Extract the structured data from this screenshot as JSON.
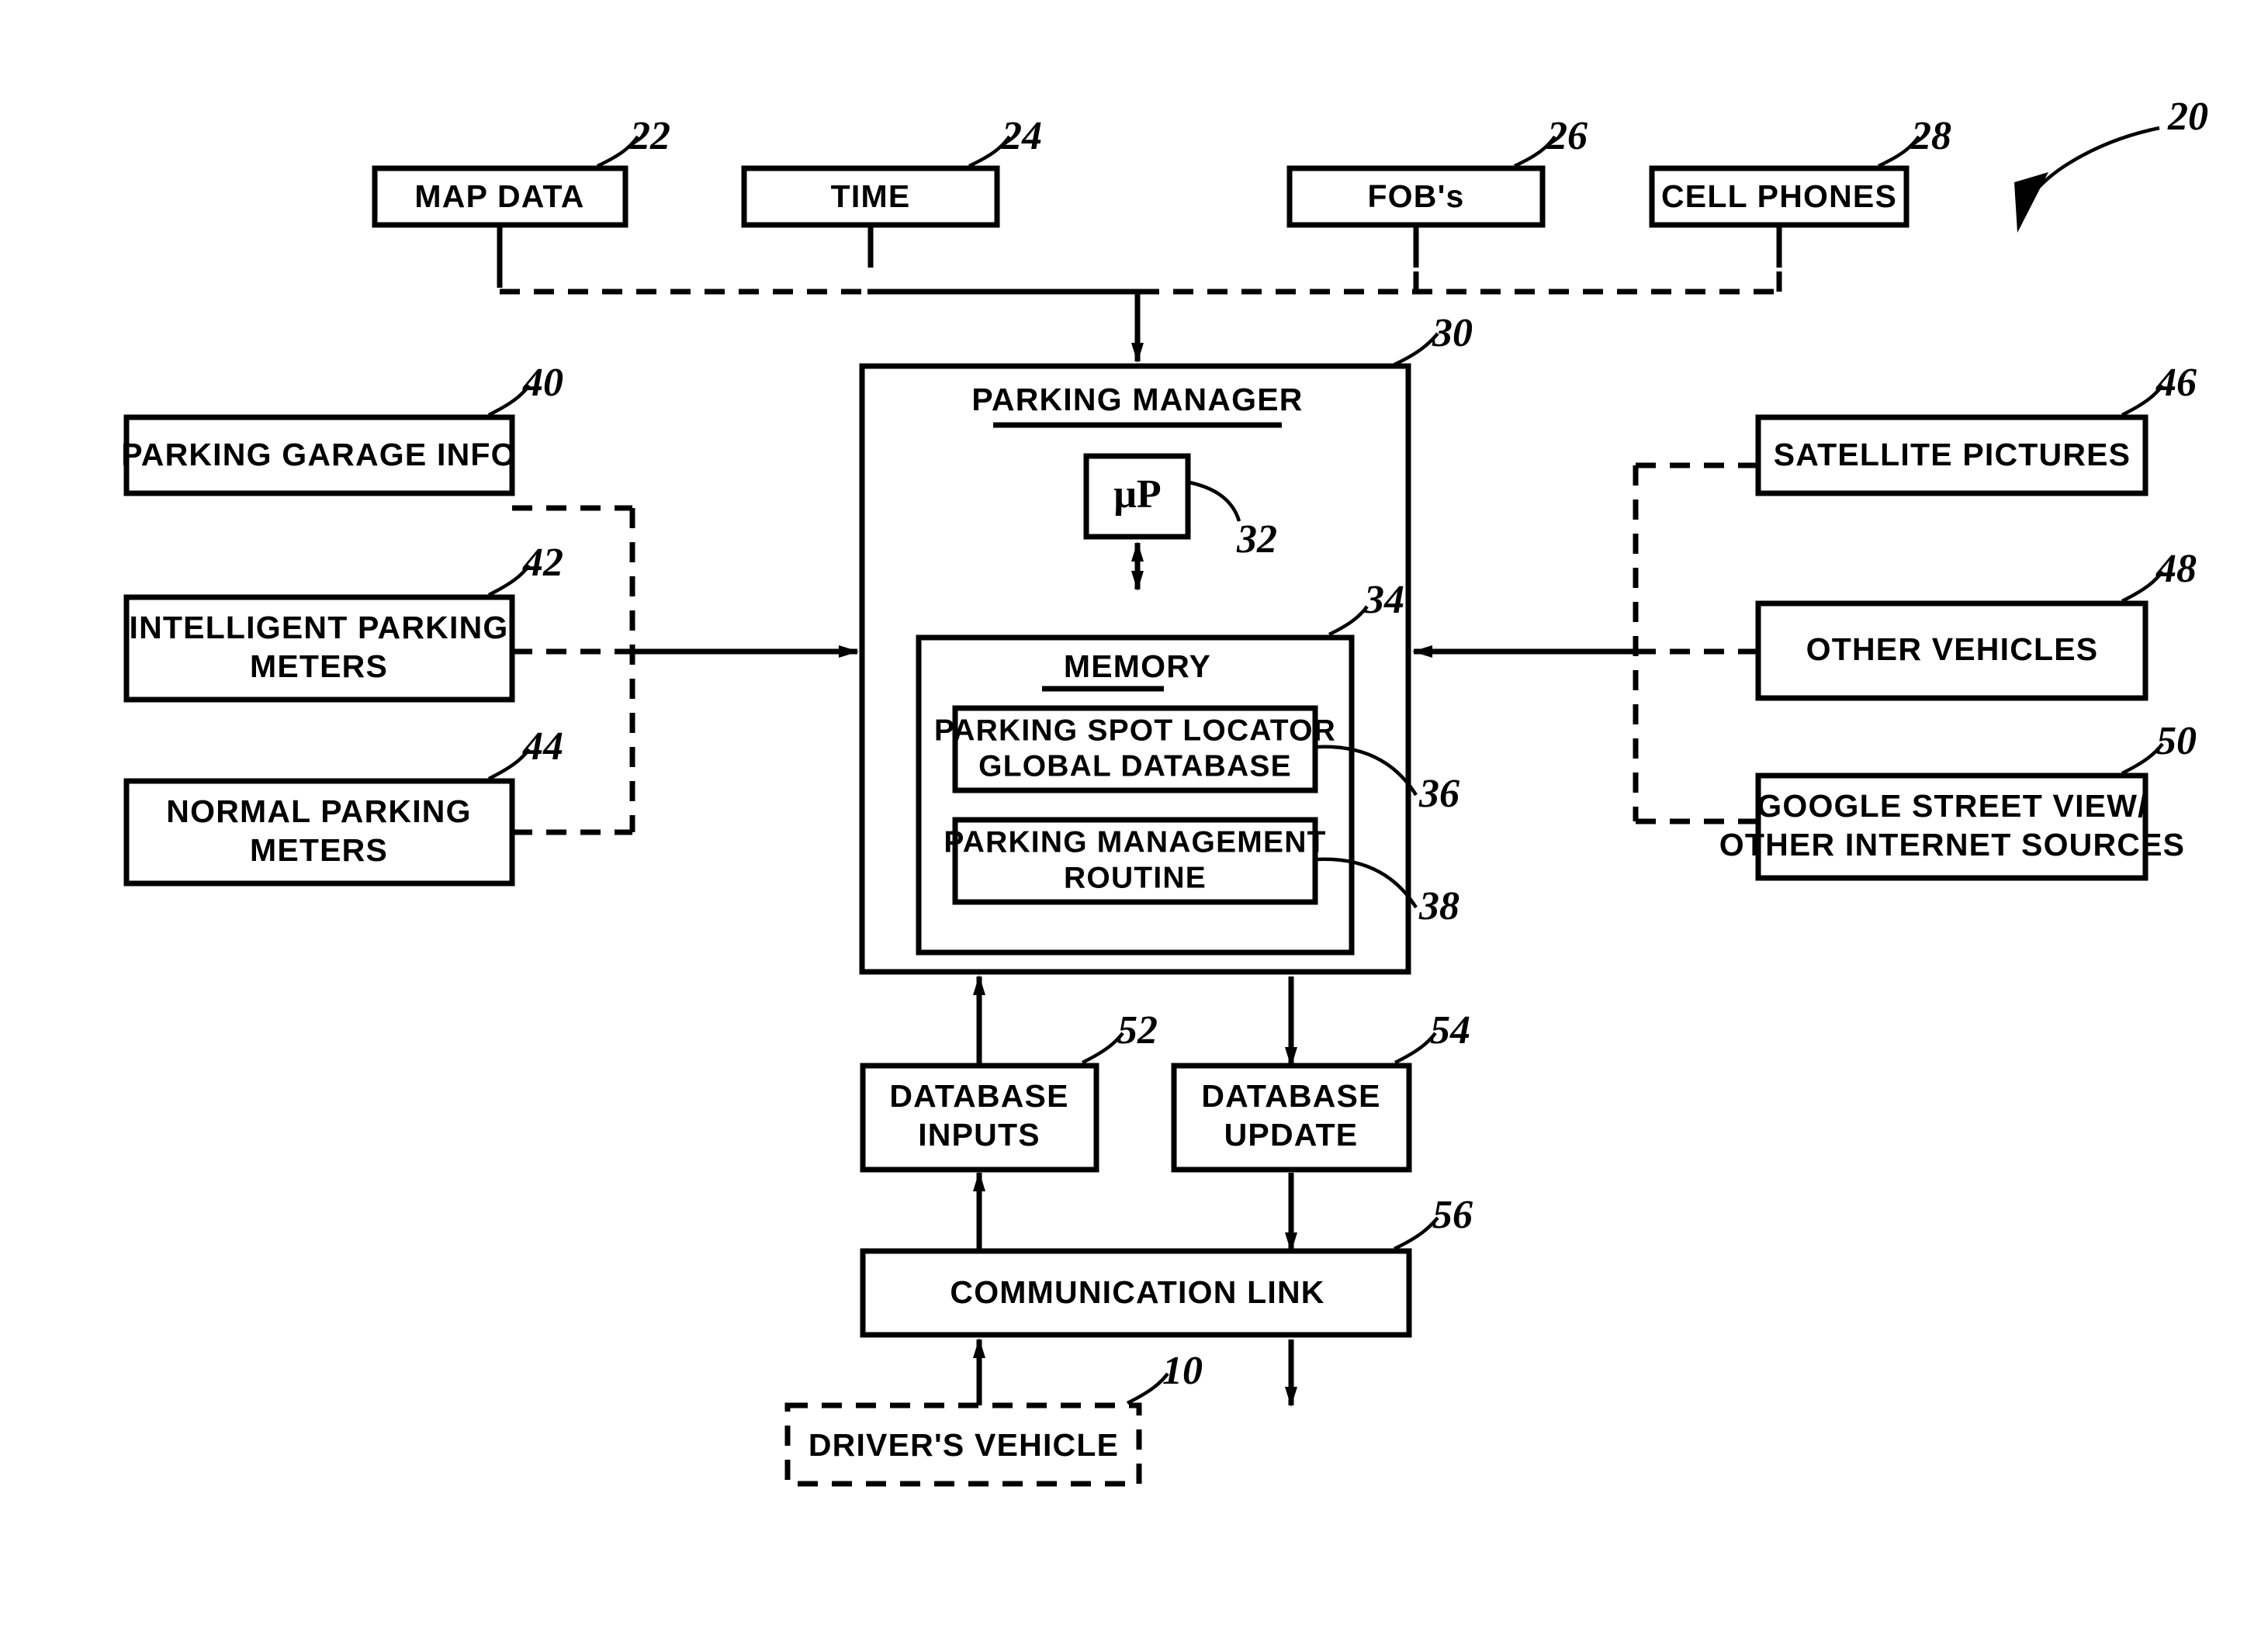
{
  "figure": {
    "title": "Parking Manager System Block Diagram",
    "system_ref": "20"
  },
  "top_inputs": [
    {
      "label": "MAP DATA",
      "ref": "22"
    },
    {
      "label": "TIME",
      "ref": "24"
    },
    {
      "label": "FOB's",
      "ref": "26"
    },
    {
      "label": "CELL PHONES",
      "ref": "28"
    }
  ],
  "left_inputs": [
    {
      "label": "PARKING GARAGE INFO",
      "line2": "",
      "ref": "40"
    },
    {
      "label": "INTELLIGENT PARKING",
      "line2": "METERS",
      "ref": "42"
    },
    {
      "label": "NORMAL PARKING",
      "line2": "METERS",
      "ref": "44"
    }
  ],
  "right_inputs": [
    {
      "label": "SATELLITE PICTURES",
      "line2": "",
      "ref": "46"
    },
    {
      "label": "OTHER VEHICLES",
      "line2": "",
      "ref": "48"
    },
    {
      "label": "GOOGLE STREET VIEW/",
      "line2": "OTHER INTERNET SOURCES",
      "ref": "50"
    }
  ],
  "parking_manager": {
    "title": "PARKING MANAGER",
    "ref": "30",
    "processor": {
      "label": "μP",
      "ref": "32"
    },
    "memory": {
      "title": "MEMORY",
      "ref": "34",
      "blocks": [
        {
          "line1": "PARKING SPOT LOCATOR",
          "line2": "GLOBAL DATABASE",
          "ref": "36"
        },
        {
          "line1": "PARKING MANAGEMENT",
          "line2": "ROUTINE",
          "ref": "38"
        }
      ]
    }
  },
  "bottom": [
    {
      "line1": "DATABASE",
      "line2": "INPUTS",
      "ref": "52"
    },
    {
      "line1": "DATABASE",
      "line2": "UPDATE",
      "ref": "54"
    }
  ],
  "communication_link": {
    "label": "COMMUNICATION LINK",
    "ref": "56"
  },
  "drivers_vehicle": {
    "label": "DRIVER'S VEHICLE",
    "ref": "10"
  },
  "colors": {
    "ink": "#000000",
    "paper": "#ffffff"
  }
}
